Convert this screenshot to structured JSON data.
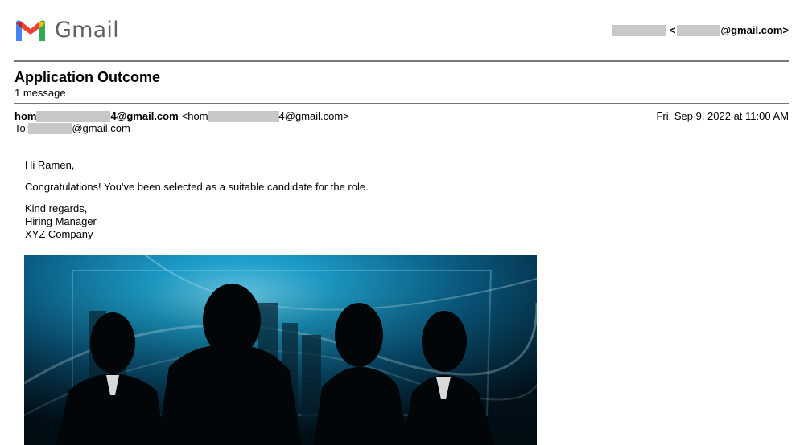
{
  "header": {
    "logo_text": "Gmail",
    "account_open": "<",
    "account_suffix": "@gmail.com>"
  },
  "thread": {
    "subject": "Application Outcome",
    "count": "1 message"
  },
  "message": {
    "from_prefix": "hom",
    "from_suffix": "4@gmail.com",
    "from_addr_prefix": "<hom",
    "from_addr_suffix": "4@gmail.com>",
    "date": "Fri, Sep 9, 2022 at 11:00 AM",
    "to_label": "To:",
    "to_suffix": "@gmail.com",
    "greeting": "Hi Ramen,",
    "body": "Congratulations! You've been selected as a suitable candidate for the role.",
    "closing": "Kind regards,",
    "sig_title": "Hiring Manager",
    "sig_company": "XYZ Company"
  },
  "icons": {
    "logo": "gmail-m-logo"
  },
  "colors": {
    "logo_red": "#EA4335",
    "logo_blue": "#4285F4",
    "logo_green": "#34A853",
    "logo_yellow": "#FBBC04",
    "rule": "#777777",
    "redaction": "#c8c8c8"
  }
}
